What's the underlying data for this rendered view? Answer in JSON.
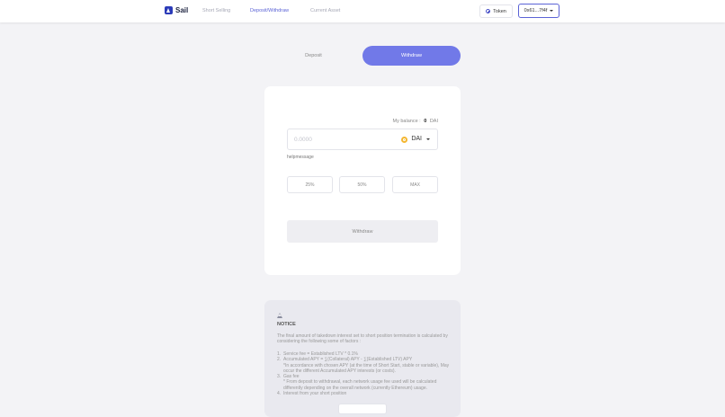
{
  "header": {
    "logo_text": "Sail",
    "nav": [
      "Short Selling",
      "Deposit/Withdraw",
      "Current Asset"
    ],
    "active_nav": "Deposit/Withdraw",
    "token_button": "Token",
    "wallet_address": "0x61...7f4f"
  },
  "tabs": [
    "Deposit",
    "Withdraw"
  ],
  "active_tab": "Withdraw",
  "form": {
    "balance_label": "My balance :",
    "balance_value": "0",
    "balance_unit": "DAI",
    "amount_placeholder": "0.0000",
    "token": "DAI",
    "help_message": "helpmessage",
    "percent_buttons": [
      "25%",
      "50%",
      "MAX"
    ],
    "submit_label": "Withdraw"
  },
  "notice": {
    "title": "NOTICE",
    "intro": "The final amount of takedown interest set to short position termination is calculated by considering the following some of factors :",
    "items": [
      {
        "num": "1.",
        "text": "Service fee = Established LTV * 0.1%",
        "sub": []
      },
      {
        "num": "2.",
        "text": "Accumulated APY = ∑(Collateral) APY - ∑(Established LTV) APY",
        "sub": [
          "*In accordance with chosen APY (at the time of Short Start, stable or variable), May occur the different Accumulated APY interests (or costs)."
        ]
      },
      {
        "num": "3.",
        "text": "Gas fee",
        "sub": [
          "* From deposit to withdrawal, each network usage fee used will be calculated differently depending on the overall network (currently Ethereum) usage."
        ]
      },
      {
        "num": "4.",
        "text": "Interest from your short position",
        "sub": []
      }
    ]
  },
  "colors": {
    "accent": "#7179e8",
    "nav_active": "#5b63d6",
    "background": "#f3f3f6"
  }
}
